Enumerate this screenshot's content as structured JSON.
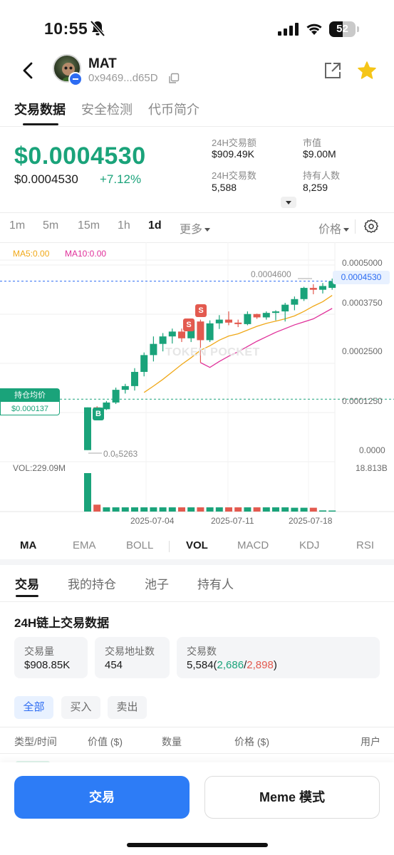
{
  "status_bar": {
    "time": "10:55",
    "battery": "52",
    "battery_level": 0.52
  },
  "header": {
    "token_name": "MAT",
    "address": "0x9469...d65D"
  },
  "top_tabs": [
    {
      "label": "交易数据",
      "active": true
    },
    {
      "label": "安全检测",
      "active": false
    },
    {
      "label": "代币简介",
      "active": false
    }
  ],
  "price": {
    "main": "$0.0004530",
    "sub": "$0.0004530",
    "change": "+7.12%"
  },
  "stats": {
    "volume_24h_label": "24H交易额",
    "volume_24h": "$909.49K",
    "market_cap_label": "市值",
    "market_cap": "$9.00M",
    "tx_count_label": "24H交易数",
    "tx_count": "5,588",
    "holders_label": "持有人数",
    "holders": "8,259"
  },
  "timeframes": [
    {
      "label": "1m",
      "active": false
    },
    {
      "label": "5m",
      "active": false
    },
    {
      "label": "15m",
      "active": false
    },
    {
      "label": "1h",
      "active": false
    },
    {
      "label": "1d",
      "active": true
    },
    {
      "label": "更多",
      "active": false
    }
  ],
  "price_mode": "价格",
  "chart": {
    "ma5_label": "MA5:0.00",
    "ma10_label": "MA10:0.00",
    "vol_label": "VOL:229.09M",
    "vol_max_label": "18.813B",
    "y_ticks": [
      "0.0005000",
      "0.0003750",
      "0.0002500",
      "0.0001250",
      "0.0000"
    ],
    "current_price_tag": "0.0004530",
    "high_label": "0.0004600",
    "low_label": "0.0₆5263",
    "hold_title": "持仓均价",
    "hold_value": "$0.000137",
    "watermark": "TOKEN POCKET",
    "x_ticks": [
      "2025-07-04",
      "2025-07-11",
      "2025-07-18"
    ],
    "colors": {
      "up": "#1aa37a",
      "down": "#e35a4f",
      "ma5": "#f0a818",
      "ma10": "#e0309a",
      "price_line": "#2d6cf2"
    },
    "markers": [
      {
        "type": "sell",
        "label": "S"
      },
      {
        "type": "sell",
        "label": "S"
      },
      {
        "type": "buy",
        "label": "B"
      }
    ]
  },
  "chart_data": {
    "type": "candlestick",
    "x_ticks": [
      "2025-07-04",
      "2025-07-11",
      "2025-07-18"
    ],
    "ylim": [
      0,
      0.0005
    ],
    "candles": [
      {
        "o": 5.3e-07,
        "h": 0.000115,
        "l": 5.3e-07,
        "c": 0.000115
      },
      {
        "o": 0.000115,
        "h": 0.000118,
        "l": 8.7e-05,
        "c": 0.00011
      },
      {
        "o": 0.00011,
        "h": 0.000132,
        "l": 0.000108,
        "c": 0.000128
      },
      {
        "o": 0.000128,
        "h": 0.000168,
        "l": 0.000124,
        "c": 0.000162
      },
      {
        "o": 0.000162,
        "h": 0.000178,
        "l": 0.000152,
        "c": 0.000172
      },
      {
        "o": 0.000172,
        "h": 0.00022,
        "l": 0.00016,
        "c": 0.00021
      },
      {
        "o": 0.00021,
        "h": 0.000262,
        "l": 0.000198,
        "c": 0.000255
      },
      {
        "o": 0.000255,
        "h": 0.000305,
        "l": 0.000238,
        "c": 0.000285
      },
      {
        "o": 0.000285,
        "h": 0.000314,
        "l": 0.000265,
        "c": 0.000305
      },
      {
        "o": 0.000305,
        "h": 0.000326,
        "l": 0.000286,
        "c": 0.000318
      },
      {
        "o": 0.000318,
        "h": 0.000326,
        "l": 0.00029,
        "c": 0.0003
      },
      {
        "o": 0.0003,
        "h": 0.000352,
        "l": 0.00029,
        "c": 0.000345
      },
      {
        "o": 0.000345,
        "h": 0.00035,
        "l": 0.000235,
        "c": 0.000295
      },
      {
        "o": 0.000295,
        "h": 0.000348,
        "l": 0.00029,
        "c": 0.00034
      },
      {
        "o": 0.00034,
        "h": 0.000362,
        "l": 0.000325,
        "c": 0.00035
      },
      {
        "o": 0.00035,
        "h": 0.000372,
        "l": 0.000335,
        "c": 0.000342
      },
      {
        "o": 0.000342,
        "h": 0.00035,
        "l": 0.00033,
        "c": 0.000338
      },
      {
        "o": 0.000338,
        "h": 0.000372,
        "l": 0.000335,
        "c": 0.000365
      },
      {
        "o": 0.000365,
        "h": 0.000366,
        "l": 0.000352,
        "c": 0.000356
      },
      {
        "o": 0.000356,
        "h": 0.000372,
        "l": 0.00035,
        "c": 0.000368
      },
      {
        "o": 0.000368,
        "h": 0.000375,
        "l": 0.000348,
        "c": 0.000372
      },
      {
        "o": 0.000372,
        "h": 0.000395,
        "l": 0.000345,
        "c": 0.00039
      },
      {
        "o": 0.00039,
        "h": 0.000412,
        "l": 0.000375,
        "c": 0.000405
      },
      {
        "o": 0.000405,
        "h": 0.000438,
        "l": 0.0004,
        "c": 0.000435
      },
      {
        "o": 0.000435,
        "h": 0.000445,
        "l": 0.000418,
        "c": 0.00043
      },
      {
        "o": 0.00043,
        "h": 0.000448,
        "l": 0.00042,
        "c": 0.00044
      },
      {
        "o": 0.000435,
        "h": 0.00046,
        "l": 0.00043,
        "c": 0.000453
      }
    ],
    "ma5": [
      null,
      null,
      null,
      null,
      null,
      null,
      0.000155,
      0.000172,
      0.00019,
      0.00021,
      0.00023,
      0.000248,
      0.000268,
      0.00028,
      0.000295,
      0.000306,
      0.000312,
      0.000322,
      0.000332,
      0.00034,
      0.000346,
      0.000352,
      0.00036,
      0.000372,
      0.000386,
      0.000398,
      0.000415
    ],
    "ma10": [
      null,
      null,
      null,
      null,
      null,
      null,
      null,
      null,
      null,
      null,
      null,
      null,
      0.000235,
      0.000222,
      0.000238,
      0.000252,
      0.000264,
      0.000278,
      0.000292,
      0.000304,
      0.000316,
      0.000326,
      0.000336,
      0.000344,
      0.000352,
      0.000366,
      0.00038
    ],
    "volume_max": "18.813B",
    "volume_levels": [
      1.0,
      0.18,
      0.11,
      0.11,
      0.11,
      0.11,
      0.11,
      0.11,
      0.11,
      0.11,
      0.11,
      0.11,
      0.11,
      0.11,
      0.11,
      0.11,
      0.11,
      0.11,
      0.11,
      0.11,
      0.11,
      0.11,
      0.1,
      0.1,
      0.1,
      0.03,
      0.02
    ],
    "current_price": 0.000453,
    "hold_avg_price": 0.000137
  },
  "indicators": [
    {
      "label": "MA",
      "active": true
    },
    {
      "label": "EMA",
      "active": false
    },
    {
      "label": "BOLL",
      "active": false
    },
    {
      "label": "VOL",
      "active": true
    },
    {
      "label": "MACD",
      "active": false
    },
    {
      "label": "KDJ",
      "active": false
    },
    {
      "label": "RSI",
      "active": false
    }
  ],
  "lower_tabs": [
    {
      "label": "交易",
      "active": true
    },
    {
      "label": "我的持仓",
      "active": false
    },
    {
      "label": "池子",
      "active": false
    },
    {
      "label": "持有人",
      "active": false
    }
  ],
  "onchain": {
    "title": "24H链上交易数据",
    "volume_label": "交易量",
    "volume": "$908.85K",
    "addresses_label": "交易地址数",
    "addresses": "454",
    "tx_label": "交易数",
    "tx_total": "5,584",
    "tx_buy": "2,686",
    "tx_sell": "2,898"
  },
  "filters": [
    {
      "label": "全部",
      "active": true
    },
    {
      "label": "买入",
      "active": false
    },
    {
      "label": "卖出",
      "active": false
    }
  ],
  "table_headers": [
    "类型/时间",
    "价值 ($)",
    "数量",
    "价格 ($)",
    "用户"
  ],
  "buttons": {
    "trade": "交易",
    "meme": "Meme 模式"
  }
}
